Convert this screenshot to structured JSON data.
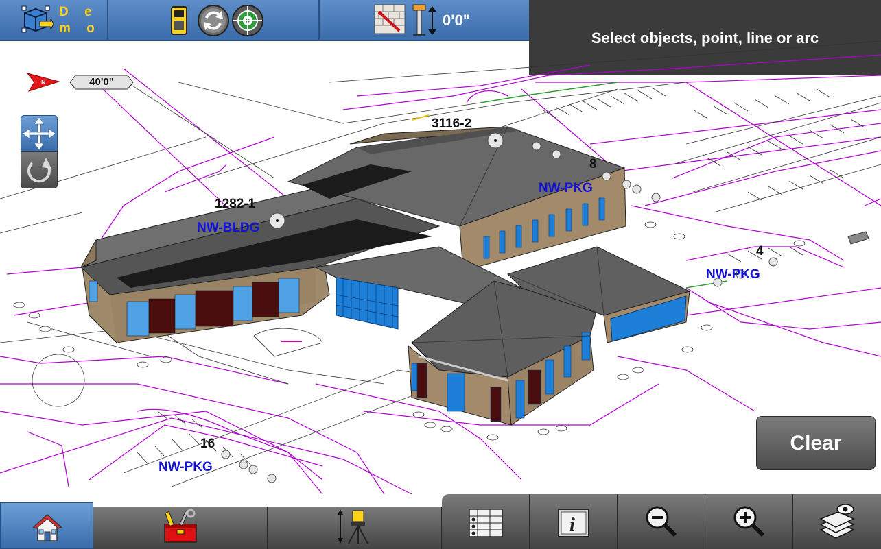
{
  "toolbar": {
    "demo_line1": "D e",
    "demo_line2": "m o",
    "level_readout": "0'0\""
  },
  "prompt": {
    "text": "Select objects, point, line or arc"
  },
  "map": {
    "scale_badge": "40'0\"",
    "labels": [
      {
        "id": "point-3116-2",
        "text": "3116-2"
      },
      {
        "id": "point-8",
        "text": "8"
      },
      {
        "id": "layer-nw-pkg-1",
        "text": "NW-PKG"
      },
      {
        "id": "point-1282-1",
        "text": "1282-1"
      },
      {
        "id": "layer-nw-bldg",
        "text": "NW-BLDG"
      },
      {
        "id": "point-4",
        "text": "4"
      },
      {
        "id": "layer-nw-pkg-2",
        "text": "NW-PKG"
      },
      {
        "id": "point-16",
        "text": "16"
      },
      {
        "id": "layer-nw-pkg-3",
        "text": "NW-PKG"
      }
    ]
  },
  "buttons": {
    "clear_label": "Clear"
  },
  "icons": {
    "top": [
      "cube-select-icon",
      "layout-device-icon",
      "refresh-icon",
      "target-icon",
      "wall-measure-icon",
      "level-elevation-icon"
    ],
    "side": [
      "pan-arrows-icon",
      "rotate-icon"
    ],
    "bottom": [
      "home-icon",
      "toolbox-icon",
      "total-station-icon",
      "table-list-icon",
      "info-icon",
      "zoom-out-icon",
      "zoom-in-icon",
      "layers-icon"
    ]
  },
  "colors": {
    "toolbar_blue": "#3b6cab",
    "demo_yellow": "#ffd21a",
    "layer_label_blue": "#1212d8",
    "cad_line_magenta": "#b000d0",
    "panel_dark": "#3b3b3b"
  }
}
